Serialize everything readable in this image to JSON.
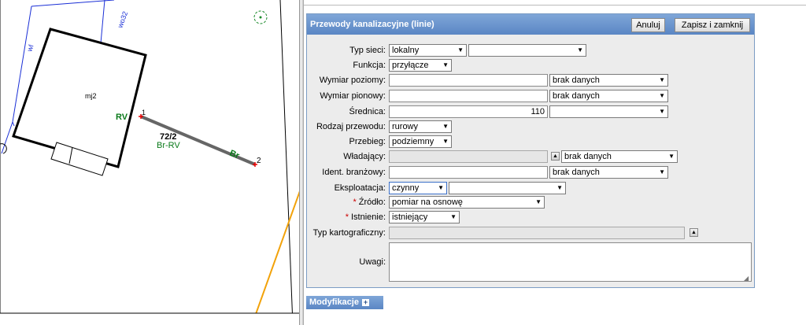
{
  "map": {
    "building_label": "mj2",
    "rv_label": "RV",
    "node1_label": "1",
    "node2_label": "2",
    "parcel_label": "72/2",
    "line_label": "Br-RV",
    "br_label": "Br",
    "line_wl_label": "wl",
    "line_wo32_label": "wo32"
  },
  "form": {
    "title": "Przewody kanalizacyjne (linie)",
    "cancel_label": "Anuluj",
    "save_close_label": "Zapisz i zamknij",
    "fields": {
      "typ_sieci": {
        "label": "Typ sieci:",
        "value": "lokalny",
        "value2": ""
      },
      "funkcja": {
        "label": "Funkcja:",
        "value": "przyłącze"
      },
      "wymiar_poziomy": {
        "label": "Wymiar poziomy:",
        "value": "",
        "unit": "brak danych"
      },
      "wymiar_pionowy": {
        "label": "Wymiar pionowy:",
        "value": "",
        "unit": "brak danych"
      },
      "srednica": {
        "label": "Średnica:",
        "value": "110",
        "unit": ""
      },
      "rodzaj_przewodu": {
        "label": "Rodzaj przewodu:",
        "value": "rurowy"
      },
      "przebieg": {
        "label": "Przebieg:",
        "value": "podziemny"
      },
      "wladajacy": {
        "label": "Władający:",
        "value": "",
        "select": "brak danych"
      },
      "ident_branzowy": {
        "label": "Ident. branżowy:",
        "value": "",
        "select": "brak danych"
      },
      "eksploatacja": {
        "label": "Eksploatacja:",
        "value": "czynny",
        "value2": ""
      },
      "zrodlo": {
        "label": "Źródło:",
        "required": "*",
        "value": "pomiar na osnowę"
      },
      "istnienie": {
        "label": "Istnienie:",
        "required": "*",
        "value": "istniejący"
      },
      "typ_kartograficzny": {
        "label": "Typ kartograficzny:",
        "value": ""
      },
      "uwagi": {
        "label": "Uwagi:",
        "value": ""
      }
    }
  },
  "modifications": {
    "label": "Modyfikacje"
  }
}
